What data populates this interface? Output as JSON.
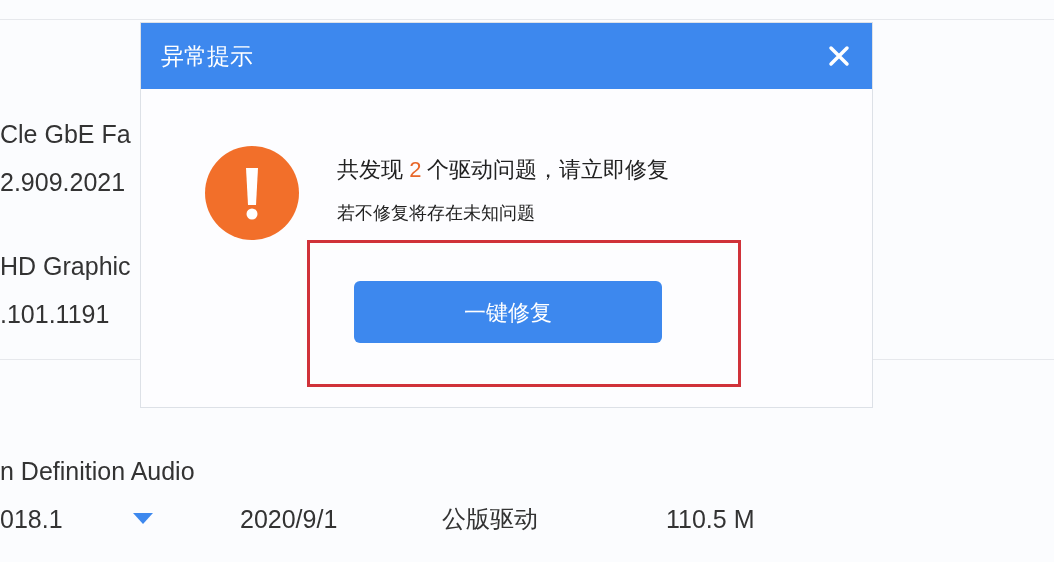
{
  "driver_list": [
    {
      "name": "Cle GbE Fa",
      "version": "2.909.2021"
    },
    {
      "name": "HD Graphic",
      "version": ".101.1191"
    },
    {
      "name": "n Definition Audio",
      "version": "018.1",
      "date": "2020/9/1",
      "type": "公版驱动",
      "size": "110.5 M"
    }
  ],
  "dialog": {
    "title": "异常提示",
    "message": {
      "prefix": "共发现 ",
      "count": "2",
      "suffix": " 个驱动问题，请立即修复"
    },
    "note": "若不修复将存在未知问题",
    "button": "一键修复"
  }
}
